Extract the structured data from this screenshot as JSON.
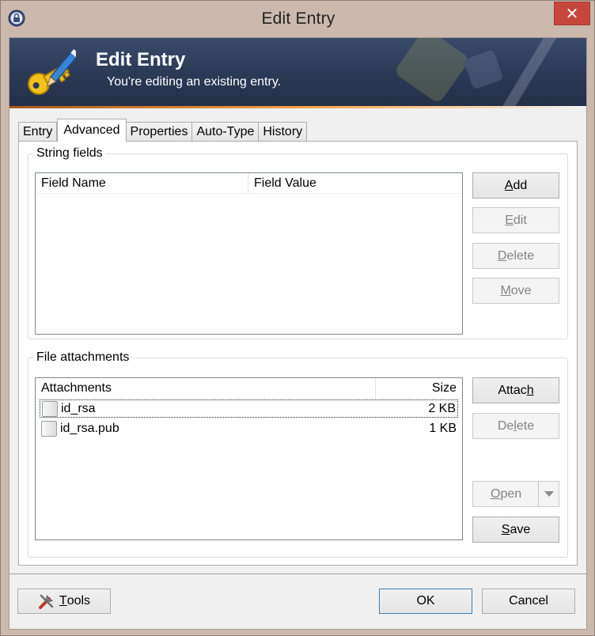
{
  "window": {
    "title": "Edit Entry",
    "close_icon": "close-icon",
    "app_icon": "keepass-lock-icon"
  },
  "banner": {
    "title": "Edit Entry",
    "subtitle": "You're editing an existing entry.",
    "icon": "key-pencil-icon"
  },
  "tabs": [
    {
      "label": "Entry",
      "active": false
    },
    {
      "label": "Advanced",
      "active": true
    },
    {
      "label": "Properties",
      "active": false
    },
    {
      "label": "Auto-Type",
      "active": false
    },
    {
      "label": "History",
      "active": false
    }
  ],
  "string_fields": {
    "legend": "String fields",
    "columns": [
      "Field Name",
      "Field Value"
    ],
    "rows": [],
    "buttons": {
      "add": {
        "pre": "",
        "key": "A",
        "post": "dd",
        "enabled": true
      },
      "edit": {
        "pre": "",
        "key": "E",
        "post": "dit",
        "enabled": false
      },
      "delete": {
        "pre": "",
        "key": "D",
        "post": "elete",
        "enabled": false
      },
      "move": {
        "pre": "",
        "key": "M",
        "post": "ove",
        "enabled": false
      }
    }
  },
  "file_attachments": {
    "legend": "File attachments",
    "columns": [
      "Attachments",
      "Size"
    ],
    "rows": [
      {
        "name": "id_rsa",
        "size": "2 KB",
        "selected": true
      },
      {
        "name": "id_rsa.pub",
        "size": "1 KB",
        "selected": false
      }
    ],
    "buttons": {
      "attach": {
        "pre": "Attac",
        "key": "h",
        "post": "",
        "enabled": true
      },
      "delete": {
        "pre": "De",
        "key": "l",
        "post": "ete",
        "enabled": false
      },
      "open": {
        "pre": "",
        "key": "O",
        "post": "pen",
        "enabled": false
      },
      "save": {
        "pre": "",
        "key": "S",
        "post": "ave",
        "enabled": true
      }
    }
  },
  "footer": {
    "tools": {
      "pre": "",
      "key": "T",
      "post": "ools",
      "icon": "tools-icon"
    },
    "ok_label": "OK",
    "cancel_label": "Cancel"
  }
}
